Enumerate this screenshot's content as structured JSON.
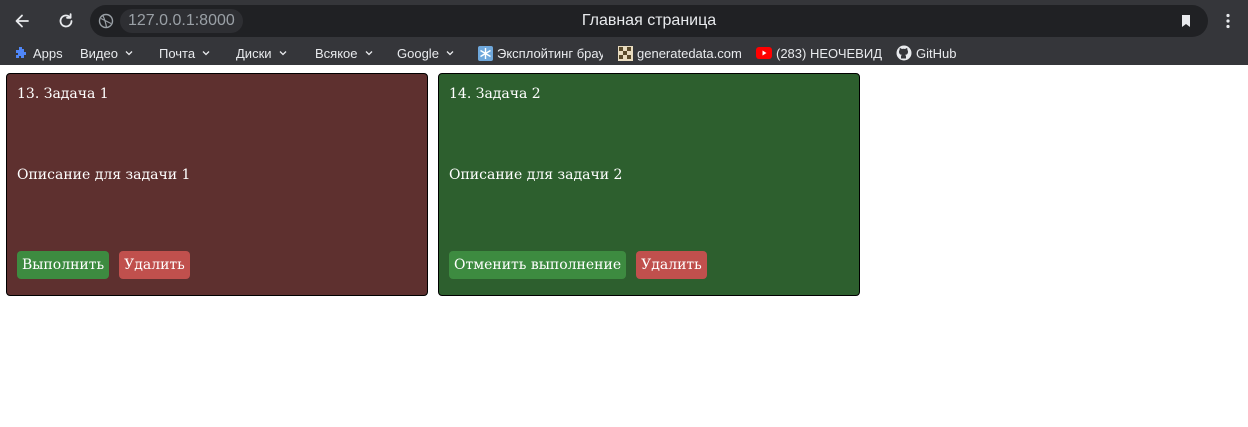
{
  "browser": {
    "url": "127.0.0.1:8000",
    "tab_title": "Главная страница",
    "bookmarks": [
      {
        "label": "Apps",
        "icon": "apps-grid-icon",
        "has_menu": false
      },
      {
        "label": "Видео",
        "icon": "",
        "has_menu": true
      },
      {
        "label": "Почта",
        "icon": "",
        "has_menu": true
      },
      {
        "label": "Диски",
        "icon": "",
        "has_menu": true
      },
      {
        "label": "Всякое",
        "icon": "",
        "has_menu": true
      },
      {
        "label": "Google",
        "icon": "",
        "has_menu": true
      },
      {
        "label": "Эксплойтинг брау",
        "icon": "snowflake-icon",
        "has_menu": false
      },
      {
        "label": "generatedata.com",
        "icon": "grid-logo-icon",
        "has_menu": false
      },
      {
        "label": "(283) НЕОЧЕВИД",
        "icon": "youtube-icon",
        "has_menu": false
      },
      {
        "label": "GitHub",
        "icon": "github-icon",
        "has_menu": false
      }
    ]
  },
  "tasks": [
    {
      "title": "13. Задача 1",
      "description": "Описание для задачи 1",
      "primary_action": "Выполнить",
      "delete_action": "Удалить",
      "color": "#5e302f"
    },
    {
      "title": "14. Задача 2",
      "description": "Описание для задачи 2",
      "primary_action": "Отменить выполнение",
      "delete_action": "Удалить",
      "color": "#2d5f2e"
    }
  ],
  "colors": {
    "chrome_bg": "#35363a",
    "omnibox_bg": "#202124",
    "done_button": "#3d8b40",
    "delete_button": "#c0504d"
  }
}
